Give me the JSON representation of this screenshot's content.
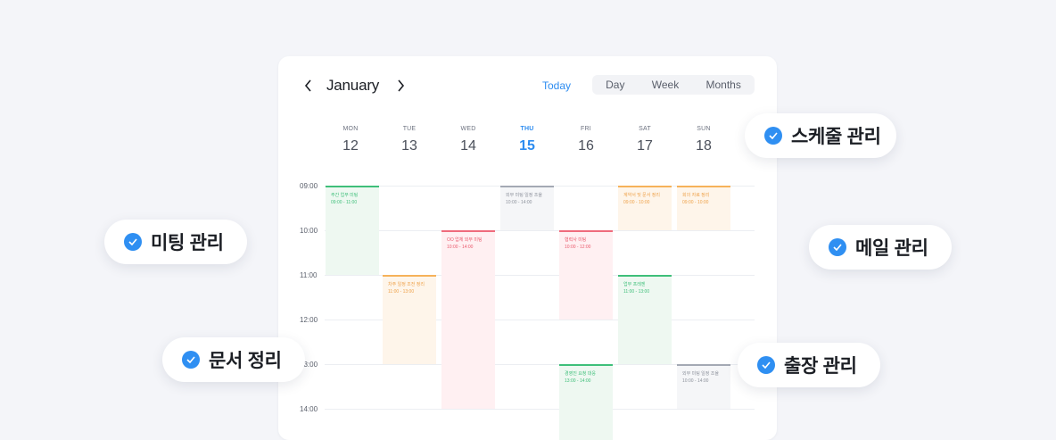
{
  "calendar": {
    "month": "January",
    "today_label": "Today",
    "views": [
      "Day",
      "Week",
      "Months"
    ],
    "days": [
      {
        "wd": "MON",
        "dn": "12"
      },
      {
        "wd": "TUE",
        "dn": "13"
      },
      {
        "wd": "WED",
        "dn": "14"
      },
      {
        "wd": "THU",
        "dn": "15"
      },
      {
        "wd": "FRI",
        "dn": "16"
      },
      {
        "wd": "SAT",
        "dn": "17"
      },
      {
        "wd": "SUN",
        "dn": "18"
      }
    ],
    "times": [
      "09:00",
      "10:00",
      "11:00",
      "12:00",
      "13:00",
      "14:00"
    ],
    "events": [
      {
        "title": "주간 업무 미팅",
        "time": "09:00 - 11:00"
      },
      {
        "title": "외부 미팅 일정 조율",
        "time": "10:00 - 14:00"
      },
      {
        "title": "계약서 및 문서 정리",
        "time": "09:00 - 10:00"
      },
      {
        "title": "회의 자료 정리",
        "time": "09:00 - 10:00"
      },
      {
        "title": "OO 업체 외부 미팅",
        "time": "10:00 - 14:00"
      },
      {
        "title": "협력사 미팅",
        "time": "10:00 - 12:00"
      },
      {
        "title": "차주 일정 조전 정리",
        "time": "11:00 - 13:00"
      },
      {
        "title": "업무 프레젠",
        "time": "11:00 - 13:00"
      },
      {
        "title": "경영진 요청 대응",
        "time": "13:00 - 14:00"
      },
      {
        "title": "외부 미팅 일정 조율",
        "time": "10:00 - 14:00"
      }
    ],
    "colors": {
      "green": "#3fbf7a",
      "gray": "#a4a9b4",
      "orange": "#f6b25a",
      "red": "#ef6b7c",
      "accent": "#2d8cf0"
    }
  },
  "features": [
    {
      "label": "스케줄 관리",
      "icon": "check-circle-icon"
    },
    {
      "label": "미팅 관리",
      "icon": "check-circle-icon"
    },
    {
      "label": "메일 관리",
      "icon": "check-circle-icon"
    },
    {
      "label": "문서 정리",
      "icon": "check-circle-icon"
    },
    {
      "label": "출장 관리",
      "icon": "check-circle-icon"
    }
  ]
}
